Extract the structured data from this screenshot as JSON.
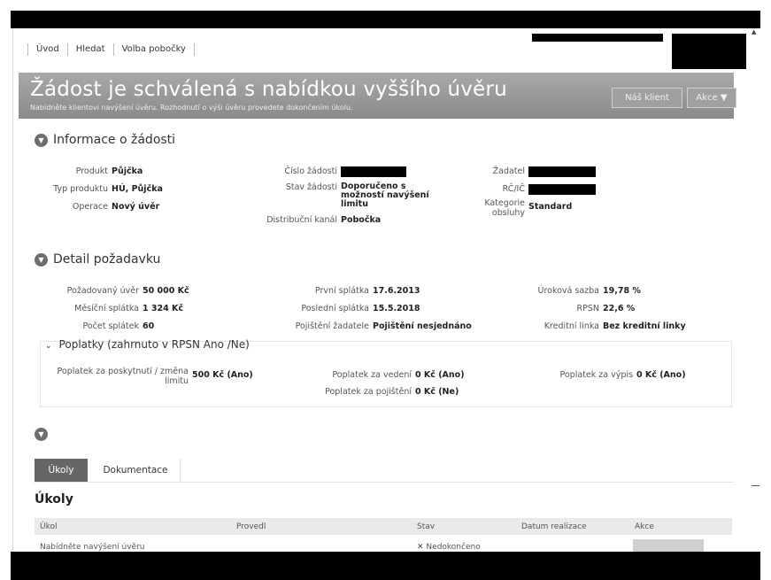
{
  "nav": {
    "items": [
      "Úvod",
      "Hledat",
      "Volba pobočky"
    ]
  },
  "banner": {
    "title": "Žádost je schválená s nabídkou vyššího úvěru",
    "subtitle": "Nabídněte klientovi navýšení úvěru. Rozhodnutí o výši úvěru provedete dokončením úkolu.",
    "btn_client": "Náš klient",
    "btn_actions": "Akce ▼"
  },
  "info": {
    "title": "Informace o žádosti",
    "produkt_label": "Produkt",
    "produkt_value": "Půjčka",
    "typ_label": "Typ produktu",
    "typ_value": "HÚ, Půjčka",
    "operace_label": "Operace",
    "operace_value": "Nový úvěr",
    "cislo_label": "Číslo žádosti",
    "stav_label": "Stav žádosti",
    "stav_value": "Doporučeno s možností navýšení limitu",
    "kanal_label": "Distribuční kanál",
    "kanal_value": "Pobočka",
    "zadatel_label": "Žadatel",
    "rc_label": "RČ/IČ",
    "kategorie_label": "Kategorie obsluhy",
    "kategorie_value": "Standard"
  },
  "detail": {
    "title": "Detail požadavku",
    "uver_label": "Požadovaný úvěr",
    "uver_value": "50 000 Kč",
    "mesicni_label": "Měsíční splátka",
    "mesicni_value": "1 324 Kč",
    "pocet_label": "Počet splátek",
    "pocet_value": "60",
    "prvni_label": "První splátka",
    "prvni_value": "17.6.2013",
    "posledni_label": "Poslední splátka",
    "posledni_value": "15.5.2018",
    "pojisteni_label": "Pojištění žadatele",
    "pojisteni_value": "Pojištění nesjednáno",
    "sazba_label": "Úroková sazba",
    "sazba_value": "19,78 %",
    "rpsn_label": "RPSN",
    "rpsn_value": "22,6 %",
    "linka_label": "Kreditní linka",
    "linka_value": "Bez kreditní linky"
  },
  "fees": {
    "title": "Poplatky (zahrnuto v RPSN Ano /Ne)",
    "poskytnuti_label": "Poplatek za poskytnutí / změna limitu",
    "poskytnuti_value": "500 Kč (Ano)",
    "vedeni_label": "Poplatek za vedení",
    "vedeni_value": "0 Kč (Ano)",
    "pojisteni_label": "Poplatek za pojištění",
    "pojisteni_value": "0 Kč (Ne)",
    "vypis_label": "Poplatek za výpis",
    "vypis_value": "0 Kč (Ano)"
  },
  "tabs": [
    "Úkoly",
    "Dokumentace"
  ],
  "tasks": {
    "heading": "Úkoly",
    "columns": [
      "Úkol",
      "Provedl",
      "Stav",
      "Datum realizace",
      "Akce"
    ],
    "row": {
      "ukol": "Nabídněte navýšení úvěru",
      "stav": "Nedokončeno"
    }
  }
}
